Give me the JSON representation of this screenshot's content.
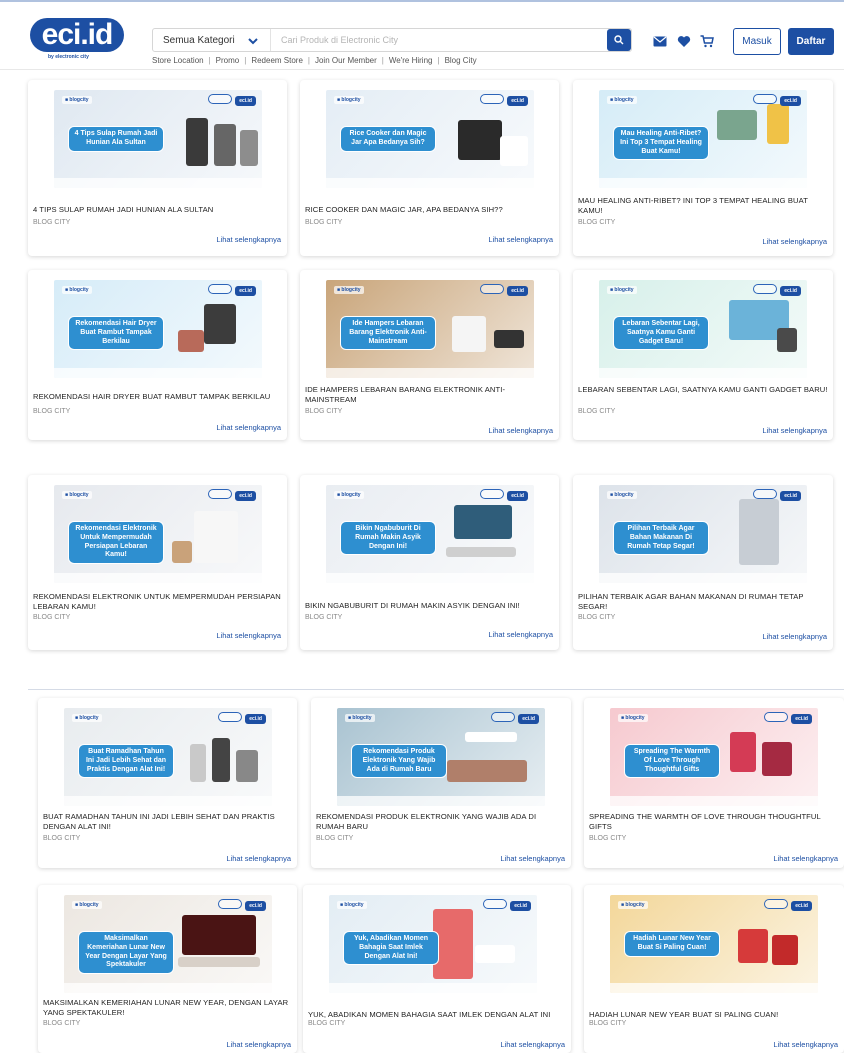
{
  "brand": {
    "logo_text": "eci.id",
    "logo_sub": "by electronic city",
    "accent": "#1d4fa3"
  },
  "search": {
    "category_label": "Semua Kategori",
    "placeholder": "Cari Produk di Electronic City"
  },
  "subnav": [
    "Store Location",
    "Promo",
    "Redeem Store",
    "Join Our Member",
    "We're Hiring",
    "Blog City"
  ],
  "auth": {
    "login_label": "Masuk",
    "register_label": "Daftar"
  },
  "icons": [
    "search-icon",
    "mail-icon",
    "heart-icon",
    "cart-icon",
    "chevron-down-icon"
  ],
  "articles": [
    {
      "title": "4 TIPS SULAP RUMAH JADI HUNIAN ALA SULTAN",
      "category": "BLOG CITY",
      "link": "Lihat selengkapnya",
      "caption": "4 Tips Sulap Rumah Jadi Hunian Ala Sultan",
      "bg": "#dfe8f1"
    },
    {
      "title": "RICE COOKER DAN MAGIC JAR, APA BEDANYA SIH??",
      "category": "BLOG CITY",
      "link": "Lihat selengkapnya",
      "caption": "Rice Cooker dan Magic Jar Apa Bedanya Sih?",
      "bg": "#e4edf5"
    },
    {
      "title": "MAU HEALING ANTI-RIBET? INI TOP 3 TEMPAT HEALING BUAT KAMU!",
      "category": "BLOG CITY",
      "link": "Lihat selengkapnya",
      "caption": "Mau Healing Anti-Ribet? Ini Top 3 Tempat Healing Buat Kamu!",
      "bg": "#d5ecf7"
    },
    {
      "title": "REKOMENDASI HAIR DRYER BUAT RAMBUT TAMPAK BERKILAU",
      "category": "BLOG CITY",
      "link": "Lihat selengkapnya",
      "caption": "Rekomendasi Hair Dryer Buat Rambut Tampak Berkilau",
      "bg": "#d6ecf8"
    },
    {
      "title": "IDE HAMPERS LEBARAN BARANG ELEKTRONIK ANTI-MAINSTREAM",
      "category": "BLOG CITY",
      "link": "Lihat selengkapnya",
      "caption": "Ide Hampers Lebaran Barang Elektronik Anti-Mainstream",
      "bg": "#c9a57a"
    },
    {
      "title": "LEBARAN SEBENTAR LAGI, SAATNYA KAMU GANTI GADGET BARU!",
      "category": "BLOG CITY",
      "link": "Lihat selengkapnya",
      "caption": "Lebaran Sebentar Lagi, Saatnya Kamu Ganti Gadget Baru!",
      "bg": "#d7f0ea"
    },
    {
      "title": "REKOMENDASI ELEKTRONIK UNTUK MEMPERMUDAH PERSIAPAN LEBARAN KAMU!",
      "category": "BLOG CITY",
      "link": "Lihat selengkapnya",
      "caption": "Rekomendasi Elektronik Untuk Mempermudah Persiapan Lebaran Kamu!",
      "bg": "#e6e9ee"
    },
    {
      "title": "BIKIN NGABUBURIT DI RUMAH MAKIN ASYIK DENGAN INI!",
      "category": "BLOG CITY",
      "link": "Lihat selengkapnya",
      "caption": "Bikin Ngabuburit Di Rumah Makin Asyik Dengan Ini!",
      "bg": "#e9edf2"
    },
    {
      "title": "PILIHAN TERBAIK AGAR BAHAN MAKANAN DI RUMAH TETAP SEGAR!",
      "category": "BLOG CITY",
      "link": "Lihat selengkapnya",
      "caption": "Pilihan Terbaik Agar Bahan Makanan Di Rumah Tetap Segar!",
      "bg": "#dde3ea"
    },
    {
      "title": "BUAT RAMADHAN TAHUN INI JADI LEBIH SEHAT DAN PRAKTIS DENGAN ALAT INI!",
      "category": "BLOG CITY",
      "link": "Lihat selengkapnya",
      "caption": "Buat Ramadhan Tahun Ini Jadi Lebih Sehat dan Praktis Dengan Alat Ini!",
      "bg": "#e8ecef"
    },
    {
      "title": "REKOMENDASI PRODUK ELEKTRONIK YANG WAJIB ADA DI RUMAH BARU",
      "category": "BLOG CITY",
      "link": "Lihat selengkapnya",
      "caption": "Rekomendasi Produk Elektronik Yang Wajib Ada di Rumah Baru",
      "bg": "#a9c3d1"
    },
    {
      "title": "SPREADING THE WARMTH OF LOVE THROUGH THOUGHTFUL GIFTS",
      "category": "BLOG CITY",
      "link": "Lihat selengkapnya",
      "caption": "Spreading The Warmth Of Love Through Thoughtful Gifts",
      "bg": "#f6c9cf"
    },
    {
      "title": "MAKSIMALKAN KEMERIAHAN LUNAR NEW YEAR, DENGAN LAYAR YANG SPEKTAKULER!",
      "category": "BLOG CITY",
      "link": "Lihat selengkapnya",
      "caption": "Maksimalkan Kemeriahan Lunar New Year Dengan Layar Yang Spektakuler",
      "bg": "#ece7e1"
    },
    {
      "title": "YUK, ABADIKAN MOMEN BAHAGIA SAAT IMLEK DENGAN ALAT INI",
      "category": "BLOG CITY",
      "link": "Lihat selengkapnya",
      "caption": "Yuk, Abadikan Momen Bahagia Saat Imlek Dengan Alat Ini!",
      "bg": "#e3edf4"
    },
    {
      "title": "HADIAH LUNAR NEW YEAR BUAT SI PALING CUAN!",
      "category": "BLOG CITY",
      "link": "Lihat selengkapnya",
      "caption": "Hadiah Lunar New Year Buat Si Paling Cuan!",
      "bg": "#f3d79a"
    }
  ]
}
